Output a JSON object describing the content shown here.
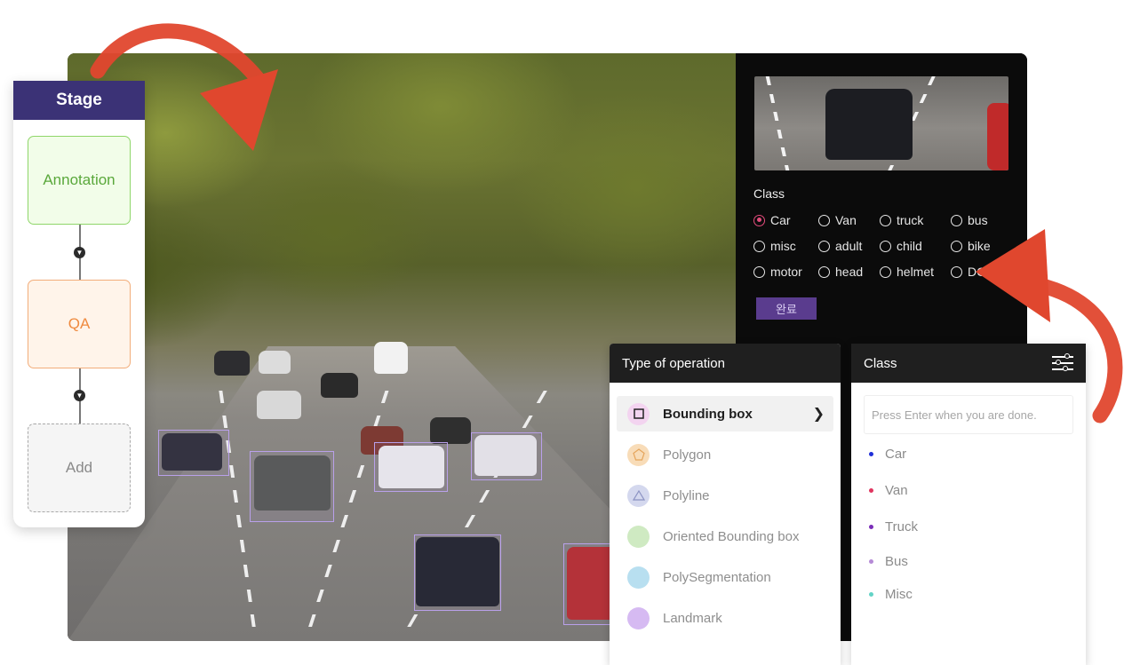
{
  "stage": {
    "title": "Stage",
    "steps": [
      {
        "label": "Annotation"
      },
      {
        "label": "QA"
      },
      {
        "label": "Add"
      }
    ]
  },
  "labeling_panel": {
    "class_label": "Class",
    "options": [
      {
        "label": "Car",
        "selected": true
      },
      {
        "label": "Van",
        "selected": false
      },
      {
        "label": "truck",
        "selected": false
      },
      {
        "label": "bus",
        "selected": false
      },
      {
        "label": "misc",
        "selected": false
      },
      {
        "label": "adult",
        "selected": false
      },
      {
        "label": "child",
        "selected": false
      },
      {
        "label": "bike",
        "selected": false
      },
      {
        "label": "motor",
        "selected": false
      },
      {
        "label": "head",
        "selected": false
      },
      {
        "label": "helmet",
        "selected": false
      },
      {
        "label": "DC",
        "selected": false
      }
    ],
    "done_button": "완료"
  },
  "operation_panel": {
    "title": "Type of operation",
    "items": [
      {
        "label": "Bounding box",
        "icon": "square-icon",
        "active": true,
        "color": "#f3d4f0"
      },
      {
        "label": "Polygon",
        "icon": "pentagon-icon",
        "active": false,
        "color": "#f8dcb8"
      },
      {
        "label": "Polyline",
        "icon": "triangle-icon",
        "active": false,
        "color": "#d4d8ee"
      },
      {
        "label": "Oriented Bounding box",
        "icon": "circle-icon",
        "active": false,
        "color": "#cfeac2"
      },
      {
        "label": "PolySegmentation",
        "icon": "circle-icon",
        "active": false,
        "color": "#b8dff0"
      },
      {
        "label": "Landmark",
        "icon": "circle-icon",
        "active": false,
        "color": "#d6baf2"
      }
    ]
  },
  "class_panel": {
    "title": "Class",
    "input_placeholder": "Press Enter when you are done.",
    "classes": [
      {
        "label": "Car",
        "color": "#1f2fd8"
      },
      {
        "label": "Van",
        "color": "#e0355f"
      },
      {
        "label": "Truck",
        "color": "#7a2db8"
      },
      {
        "label": "Bus",
        "color": "#b58ad6"
      },
      {
        "label": "Misc",
        "color": "#62d3c6"
      }
    ]
  },
  "colors": {
    "stage_header": "#3b3276",
    "accent_arrow": "#e0472e",
    "bbox": "#b9a0ea",
    "done_button": "#5a3c8e"
  }
}
